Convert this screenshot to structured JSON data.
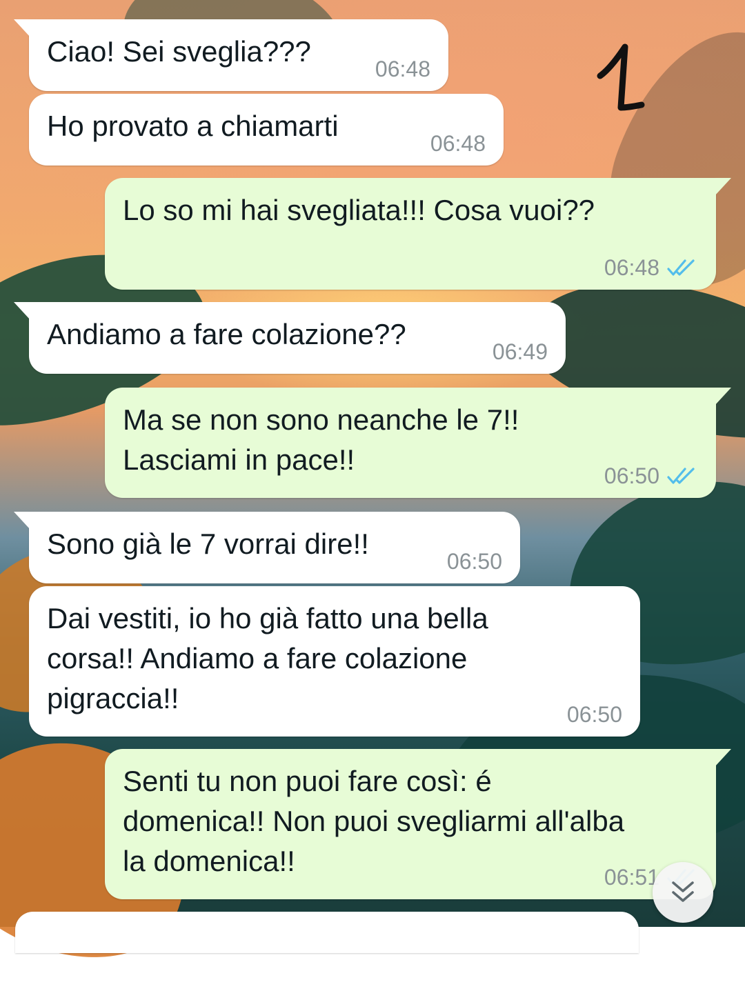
{
  "annotation": {
    "number": "1"
  },
  "messages": [
    {
      "dir": "in",
      "text": "Ciao! Sei sveglia???",
      "time": "06:48"
    },
    {
      "dir": "in",
      "text": "Ho provato a chiamarti",
      "time": "06:48"
    },
    {
      "dir": "out",
      "text": "Lo so mi hai svegliata!!! Cosa vuoi??",
      "time": "06:48",
      "status": "read"
    },
    {
      "dir": "in",
      "text": "Andiamo a fare colazione??",
      "time": "06:49"
    },
    {
      "dir": "out",
      "text": "Ma se non sono neanche le 7!!\nLasciami in pace!!",
      "time": "06:50",
      "status": "read"
    },
    {
      "dir": "in",
      "text": "Sono già le 7 vorrai dire!!",
      "time": "06:50"
    },
    {
      "dir": "in",
      "text": "Dai vestiti, io ho già fatto una bella\ncorsa!! Andiamo a fare colazione\npigraccia!!",
      "time": "06:50"
    },
    {
      "dir": "out",
      "text": "Senti tu non puoi fare così: é\ndomenica!! Non puoi svegliarmi all'alba\nla domenica!!",
      "time": "06:51",
      "status": "read"
    }
  ],
  "colors": {
    "incoming_bubble": "#ffffff",
    "outgoing_bubble": "#e7fcd6",
    "read_ticks": "#53bdeb",
    "timestamp": "#8a9296"
  },
  "icons": {
    "read_receipt": "double-check-icon",
    "scroll_down": "double-chevron-down-icon"
  }
}
